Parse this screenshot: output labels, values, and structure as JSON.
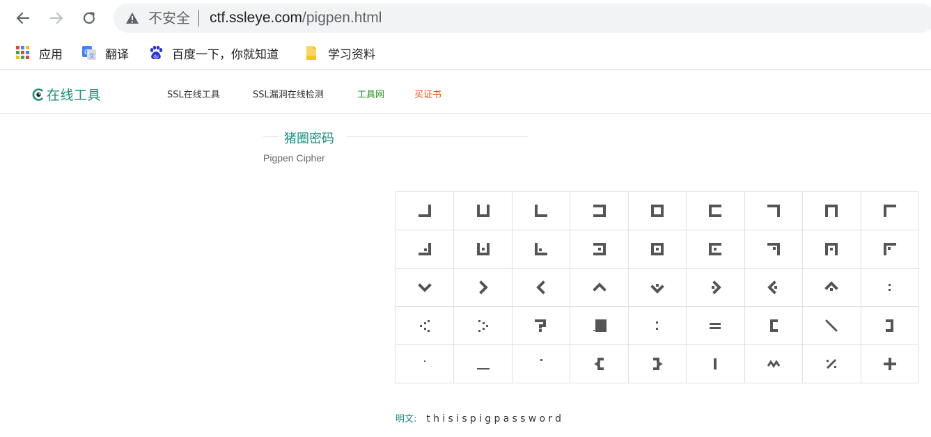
{
  "browser": {
    "security_label": "不安全",
    "url_host": "ctf.ssleye.com",
    "url_path": "/pigpen.html",
    "bookmarks": [
      {
        "label": "应用",
        "icon": "apps-grid-icon"
      },
      {
        "label": "翻译",
        "icon": "google-translate-icon"
      },
      {
        "label": "百度一下，你就知道",
        "icon": "baidu-paw-icon"
      },
      {
        "label": "学习资料",
        "icon": "folder-icon"
      }
    ]
  },
  "site": {
    "logo_text": "在线工具",
    "nav": [
      {
        "label": "SSL在线工具"
      },
      {
        "label": "SSL漏洞在线检测"
      },
      {
        "label": "工具网"
      },
      {
        "label": "买证书"
      }
    ]
  },
  "section": {
    "title": "猪圈密码",
    "subtitle": "Pigpen Cipher"
  },
  "cipher_rows": [
    [
      "pigpen-corner-br",
      "pigpen-u",
      "pigpen-corner-bl",
      "pigpen-bracket-right",
      "pigpen-box",
      "pigpen-bracket-left",
      "pigpen-corner-tr",
      "pigpen-n",
      "pigpen-corner-tl"
    ],
    [
      "pigpen-corner-br-dot",
      "pigpen-u-dot",
      "pigpen-corner-bl-dot",
      "pigpen-bracket-right-dot",
      "pigpen-box-dot",
      "pigpen-bracket-left-dot",
      "pigpen-corner-tr-dot",
      "pigpen-n-dot",
      "pigpen-corner-tl-dot"
    ],
    [
      "pigpen-v-down",
      "pigpen-chevron-right",
      "pigpen-chevron-left",
      "pigpen-v-up",
      "pigpen-v-down-dot",
      "pigpen-chevron-right-dot",
      "pigpen-chevron-left-dot",
      "pigpen-v-up-dot",
      "symbol-colon-small"
    ],
    [
      "symbol-dots-left",
      "symbol-dots-right",
      "symbol-question",
      "symbol-dot-box",
      "symbol-colon",
      "symbol-equals",
      "symbol-bracket-open",
      "symbol-backslash",
      "symbol-bracket-close"
    ],
    [
      "symbol-apostrophe",
      "symbol-underscore",
      "symbol-dot-top",
      "symbol-brace-open",
      "symbol-brace-close",
      "symbol-pipe",
      "symbol-tilde",
      "symbol-percent",
      "symbol-plus"
    ]
  ],
  "plaintext": {
    "label": "明文:",
    "value": "thisispigpassword"
  },
  "colors": {
    "accent": "#1a8e7c",
    "link_green": "#1e8f1e",
    "link_orange": "#e8540c",
    "glyph": "#555555"
  }
}
